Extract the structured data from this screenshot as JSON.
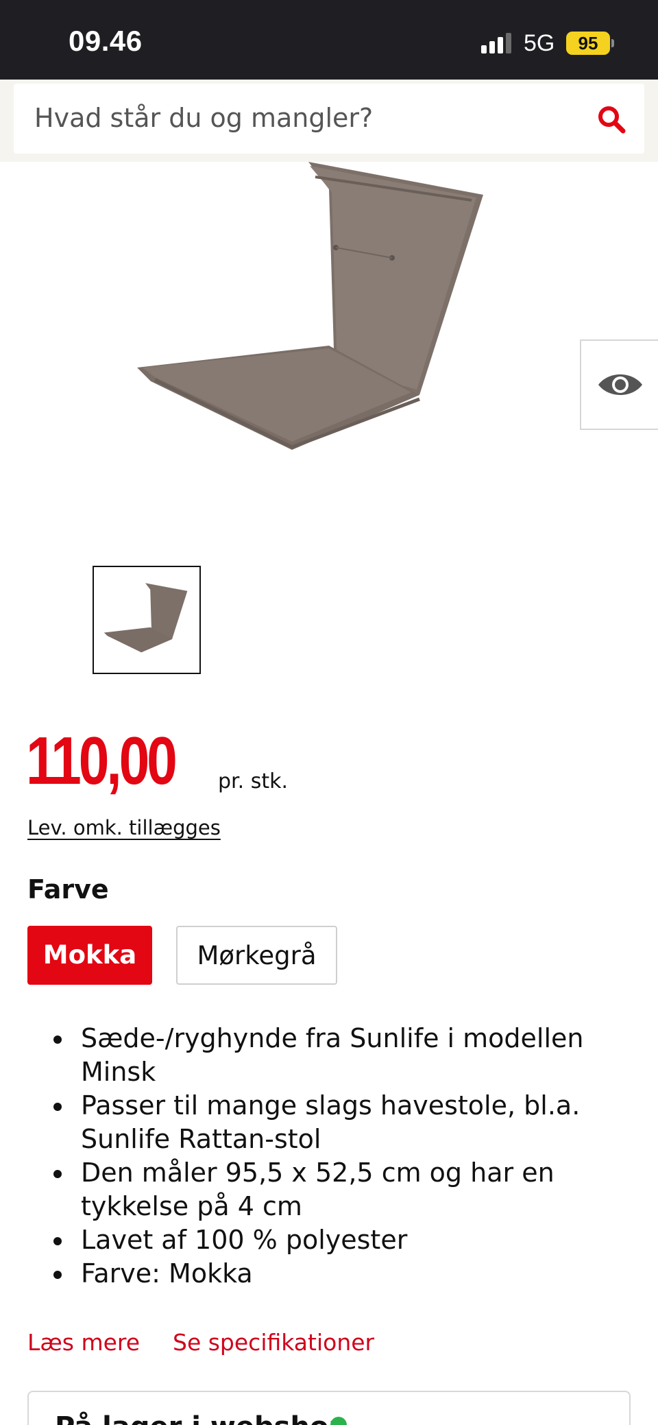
{
  "status_bar": {
    "time": "09.46",
    "network": "5G",
    "battery": "95"
  },
  "search": {
    "placeholder": "Hvad står du og mangler?",
    "accent_color": "#e30613"
  },
  "product": {
    "price": "110,00",
    "price_unit": "pr. stk.",
    "delivery_link": "Lev. omk. tillægges",
    "color_heading": "Farve",
    "color_options": [
      "Mokka",
      "Mørkegrå"
    ],
    "selected_color": "Mokka",
    "features": [
      "Sæde-/ryghynde fra Sunlife i modellen Minsk",
      "Passer til mange slags havestole, bl.a. Sunlife Rattan-stol",
      "Den måler 95,5 x 52,5 cm og har en tykkelse på 4 cm",
      "Lavet af 100 % polyester",
      "Farve: Mokka"
    ],
    "read_more": "Læs mere",
    "see_specs": "Se specifikationer"
  },
  "stock_card": {
    "title": "På lager i webshop"
  },
  "icons": {
    "search": "search-icon",
    "view": "eye-icon"
  }
}
